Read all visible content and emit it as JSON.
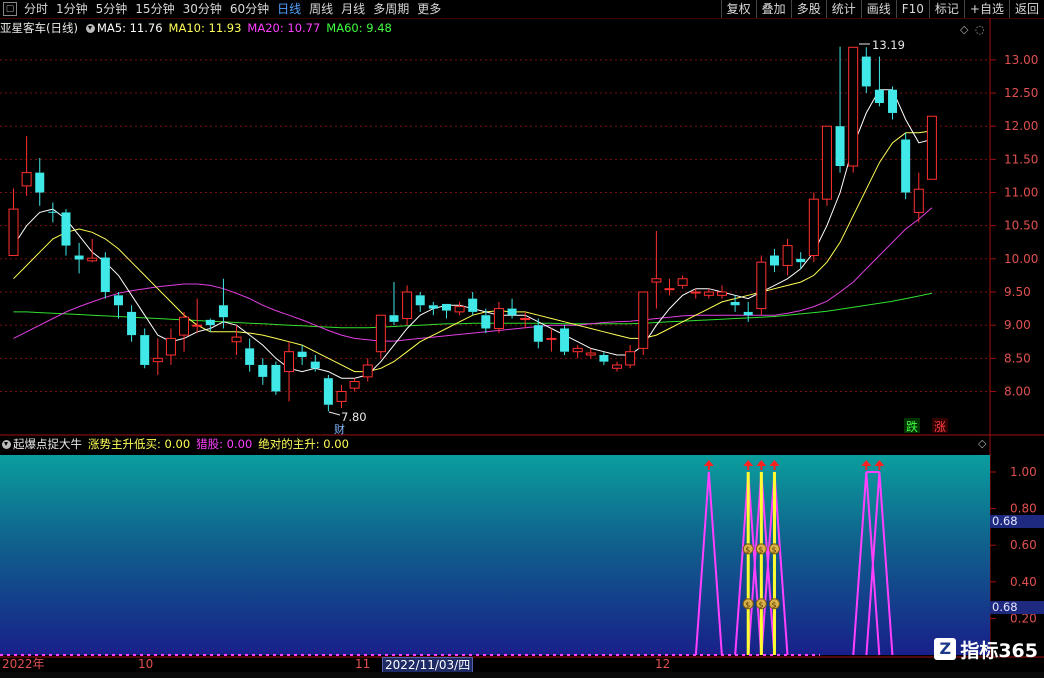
{
  "toolbar": {
    "periods": [
      "分时",
      "1分钟",
      "5分钟",
      "15分钟",
      "30分钟",
      "60分钟",
      "日线",
      "周线",
      "月线",
      "多周期",
      "更多"
    ],
    "active_period": "日线",
    "right_buttons": [
      "复权",
      "叠加",
      "多股",
      "统计",
      "画线",
      "F10",
      "标记",
      "+自选",
      "返回"
    ]
  },
  "main_legend": {
    "title": "亚星客车(日线)",
    "ma5": "MA5: 11.76",
    "ma10": "MA10: 11.93",
    "ma20": "MA20: 10.77",
    "ma60": "MA60: 9.48",
    "colors": {
      "title": "#e8e8e8",
      "ma5": "#ffffff",
      "ma10": "#ffff55",
      "ma20": "#ff40ff",
      "ma60": "#40ff40"
    }
  },
  "indicator_legend": {
    "title": "起爆点捉大牛",
    "s1": "涨势主升低买: 0.00",
    "s2": "猎股: 0.00",
    "s3": "绝对的主升: 0.00",
    "colors": {
      "title": "#e8e8e8",
      "s1": "#ffff55",
      "s2": "#ff40ff",
      "s3": "#ffff55"
    }
  },
  "chart_data": [
    {
      "type": "candlestick",
      "ylim": [
        7.6,
        13.3
      ],
      "y_ticks": [
        "13.00",
        "12.50",
        "12.00",
        "11.50",
        "11.00",
        "10.50",
        "10.00",
        "9.50",
        "9.00",
        "8.50",
        "8.00"
      ],
      "y_tick_values": [
        13.0,
        12.5,
        12.0,
        11.5,
        11.0,
        10.5,
        10.0,
        9.5,
        9.0,
        8.5,
        8.0
      ],
      "candles": [
        [
          10.05,
          10.75,
          10.05,
          11.06
        ],
        [
          11.1,
          11.3,
          10.95,
          11.85
        ],
        [
          11.3,
          11.0,
          10.8,
          11.52
        ],
        [
          10.71,
          10.7,
          10.55,
          10.85
        ],
        [
          10.7,
          10.2,
          10.05,
          10.75
        ],
        [
          10.05,
          9.99,
          9.78,
          10.24
        ],
        [
          9.97,
          10.01,
          9.95,
          10.3
        ],
        [
          10.02,
          9.5,
          9.4,
          10.1
        ],
        [
          9.45,
          9.3,
          9.1,
          9.5
        ],
        [
          9.2,
          8.85,
          8.75,
          9.3
        ],
        [
          8.85,
          8.4,
          8.35,
          8.95
        ],
        [
          8.45,
          8.5,
          8.25,
          8.8
        ],
        [
          8.55,
          8.8,
          8.4,
          8.95
        ],
        [
          8.85,
          9.12,
          8.6,
          9.2
        ],
        [
          9.0,
          9.0,
          8.88,
          9.4
        ],
        [
          9.08,
          9.0,
          8.9,
          9.1
        ],
        [
          9.3,
          9.12,
          8.95,
          9.7
        ],
        [
          8.75,
          8.82,
          8.55,
          9.0
        ],
        [
          8.65,
          8.4,
          8.3,
          8.8
        ],
        [
          8.4,
          8.22,
          8.1,
          8.5
        ],
        [
          8.4,
          8.0,
          7.95,
          8.45
        ],
        [
          8.3,
          8.6,
          7.85,
          8.75
        ],
        [
          8.6,
          8.52,
          8.4,
          8.7
        ],
        [
          8.45,
          8.35,
          8.3,
          8.55
        ],
        [
          8.2,
          7.8,
          7.7,
          8.25
        ],
        [
          7.85,
          8.0,
          7.75,
          8.1
        ],
        [
          8.05,
          8.15,
          8.0,
          8.2
        ],
        [
          8.22,
          8.4,
          8.15,
          8.5
        ],
        [
          8.6,
          9.15,
          8.5,
          9.15
        ],
        [
          9.15,
          9.05,
          9.0,
          9.65
        ],
        [
          9.1,
          9.5,
          9.0,
          9.6
        ],
        [
          9.45,
          9.3,
          9.2,
          9.5
        ],
        [
          9.3,
          9.25,
          9.15,
          9.35
        ],
        [
          9.32,
          9.22,
          9.1,
          9.3
        ],
        [
          9.2,
          9.28,
          9.15,
          9.35
        ],
        [
          9.4,
          9.2,
          9.15,
          9.5
        ],
        [
          9.15,
          8.95,
          8.88,
          9.25
        ],
        [
          8.95,
          9.25,
          8.88,
          9.35
        ],
        [
          9.25,
          9.15,
          9.1,
          9.4
        ],
        [
          9.1,
          9.1,
          8.95,
          9.2
        ],
        [
          9.0,
          8.75,
          8.65,
          9.1
        ],
        [
          8.8,
          8.8,
          8.6,
          8.95
        ],
        [
          8.95,
          8.6,
          8.55,
          9.0
        ],
        [
          8.6,
          8.65,
          8.5,
          8.7
        ],
        [
          8.55,
          8.58,
          8.5,
          8.65
        ],
        [
          8.55,
          8.45,
          8.4,
          8.6
        ],
        [
          8.35,
          8.4,
          8.3,
          8.45
        ],
        [
          8.4,
          8.6,
          8.35,
          8.7
        ],
        [
          8.65,
          9.5,
          8.55,
          9.5
        ],
        [
          9.65,
          9.7,
          9.25,
          10.42
        ],
        [
          9.55,
          9.55,
          9.45,
          9.7
        ],
        [
          9.6,
          9.7,
          9.55,
          9.75
        ],
        [
          9.5,
          9.5,
          9.4,
          9.55
        ],
        [
          9.45,
          9.5,
          9.4,
          9.55
        ],
        [
          9.45,
          9.5,
          9.4,
          9.6
        ],
        [
          9.35,
          9.3,
          9.2,
          9.45
        ],
        [
          9.2,
          9.15,
          9.05,
          9.35
        ],
        [
          9.25,
          9.95,
          9.15,
          10.05
        ],
        [
          10.05,
          9.9,
          9.8,
          10.15
        ],
        [
          9.9,
          10.2,
          9.75,
          10.3
        ],
        [
          10.0,
          9.95,
          9.85,
          10.1
        ],
        [
          10.05,
          10.9,
          9.95,
          11.0
        ],
        [
          10.9,
          12.0,
          10.8,
          12.0
        ],
        [
          12.0,
          11.4,
          11.3,
          13.2
        ],
        [
          11.4,
          13.19,
          11.3,
          13.19
        ],
        [
          13.05,
          12.6,
          12.5,
          13.19
        ],
        [
          12.55,
          12.35,
          12.3,
          13.05
        ],
        [
          12.55,
          12.2,
          12.1,
          12.6
        ],
        [
          11.8,
          11.0,
          10.9,
          11.9
        ],
        [
          10.7,
          11.05,
          10.55,
          11.3
        ],
        [
          11.2,
          12.15,
          11.2,
          12.15
        ]
      ],
      "high_label": "13.19",
      "low_label": "7.80",
      "low_marker": "财",
      "down_marker": "跌",
      "up_marker": "涨",
      "ma5": [
        10.2,
        10.5,
        10.7,
        10.75,
        10.6,
        10.35,
        10.1,
        9.95,
        9.75,
        9.45,
        9.15,
        8.85,
        8.75,
        8.8,
        8.9,
        8.95,
        9.05,
        9.0,
        8.85,
        8.7,
        8.5,
        8.35,
        8.3,
        8.35,
        8.3,
        8.2,
        8.2,
        8.25,
        8.45,
        8.7,
        8.95,
        9.15,
        9.25,
        9.3,
        9.3,
        9.25,
        9.2,
        9.15,
        9.15,
        9.15,
        9.05,
        8.95,
        8.85,
        8.75,
        8.65,
        8.6,
        8.55,
        8.55,
        8.7,
        9.0,
        9.25,
        9.45,
        9.55,
        9.55,
        9.5,
        9.45,
        9.4,
        9.5,
        9.6,
        9.7,
        9.85,
        10.1,
        10.5,
        11.0,
        11.7,
        12.2,
        12.55,
        12.55,
        12.1,
        11.75,
        11.8
      ],
      "ma10": [
        9.7,
        9.9,
        10.1,
        10.3,
        10.4,
        10.45,
        10.4,
        10.3,
        10.15,
        9.95,
        9.75,
        9.55,
        9.35,
        9.15,
        9.0,
        8.9,
        8.9,
        8.9,
        8.88,
        8.85,
        8.8,
        8.75,
        8.7,
        8.6,
        8.5,
        8.4,
        8.3,
        8.3,
        8.35,
        8.45,
        8.6,
        8.75,
        8.85,
        8.95,
        9.05,
        9.15,
        9.2,
        9.22,
        9.2,
        9.2,
        9.15,
        9.1,
        9.05,
        9.0,
        8.95,
        8.9,
        8.85,
        8.8,
        8.8,
        8.85,
        8.95,
        9.05,
        9.15,
        9.25,
        9.35,
        9.4,
        9.45,
        9.5,
        9.55,
        9.6,
        9.65,
        9.75,
        9.95,
        10.25,
        10.65,
        11.05,
        11.45,
        11.75,
        11.9,
        11.9,
        11.93
      ],
      "ma20": [
        8.8,
        8.9,
        9.0,
        9.1,
        9.2,
        9.28,
        9.35,
        9.42,
        9.48,
        9.52,
        9.55,
        9.58,
        9.6,
        9.62,
        9.62,
        9.6,
        9.55,
        9.48,
        9.4,
        9.3,
        9.22,
        9.15,
        9.08,
        9.0,
        8.92,
        8.85,
        8.8,
        8.78,
        8.76,
        8.76,
        8.78,
        8.8,
        8.82,
        8.84,
        8.86,
        8.88,
        8.9,
        8.92,
        8.94,
        8.96,
        8.98,
        9.0,
        9.0,
        9.0,
        9.02,
        9.04,
        9.05,
        9.06,
        9.08,
        9.1,
        9.12,
        9.14,
        9.15,
        9.15,
        9.15,
        9.15,
        9.15,
        9.15,
        9.15,
        9.18,
        9.22,
        9.28,
        9.36,
        9.5,
        9.65,
        9.85,
        10.05,
        10.25,
        10.45,
        10.6,
        10.77
      ],
      "ma60": [
        9.2,
        9.2,
        9.19,
        9.18,
        9.17,
        9.16,
        9.15,
        9.14,
        9.13,
        9.12,
        9.11,
        9.1,
        9.09,
        9.08,
        9.07,
        9.06,
        9.05,
        9.04,
        9.03,
        9.02,
        9.01,
        9.0,
        8.99,
        8.98,
        8.97,
        8.96,
        8.96,
        8.96,
        8.97,
        8.98,
        8.99,
        9.0,
        9.01,
        9.02,
        9.02,
        9.03,
        9.03,
        9.03,
        9.03,
        9.03,
        9.03,
        9.03,
        9.02,
        9.02,
        9.02,
        9.02,
        9.02,
        9.02,
        9.03,
        9.04,
        9.05,
        9.06,
        9.07,
        9.08,
        9.09,
        9.1,
        9.11,
        9.12,
        9.13,
        9.15,
        9.17,
        9.19,
        9.21,
        9.24,
        9.27,
        9.3,
        9.33,
        9.36,
        9.4,
        9.44,
        9.48
      ]
    },
    {
      "type": "indicator",
      "y_ticks": [
        "1.00",
        "0.80",
        "0.60",
        "0.40",
        "0.20"
      ],
      "y_tick_values": [
        1.0,
        0.8,
        0.6,
        0.4,
        0.2
      ],
      "value_boxes": [
        "0.68",
        "0.68"
      ],
      "spikes_magenta": [
        53,
        56,
        57,
        58,
        65,
        66
      ],
      "spikes_yellow": [
        56,
        57,
        58
      ],
      "arrow_indices": [
        53,
        56,
        57,
        58,
        65,
        66
      ]
    }
  ],
  "x_axis": {
    "labels": [
      "2022年",
      "10",
      "11",
      "2022/11/03/四",
      "12"
    ]
  },
  "watermark": {
    "logo": "Z",
    "text": "指标365"
  }
}
